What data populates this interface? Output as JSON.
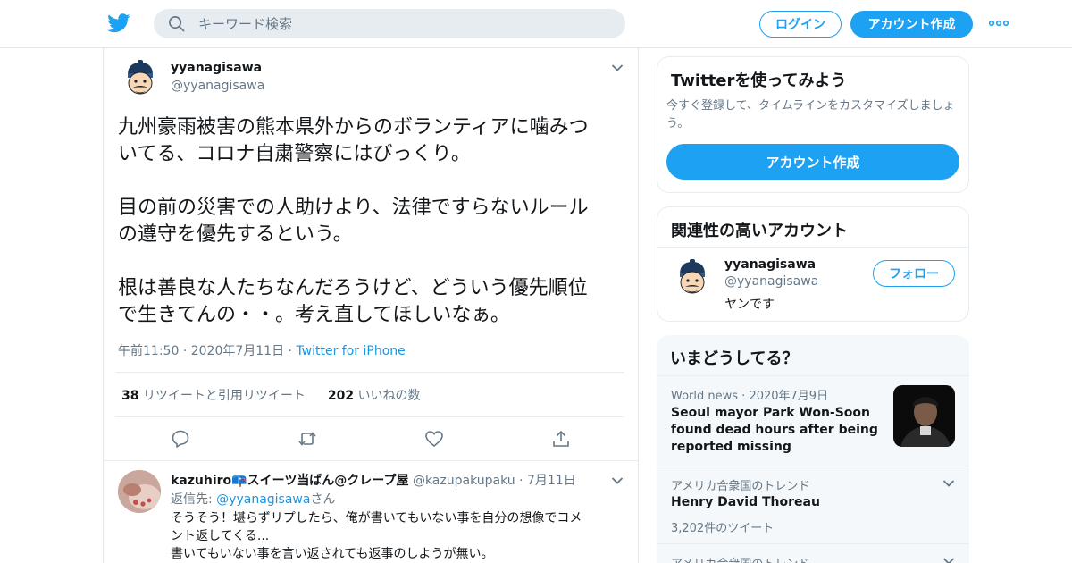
{
  "header": {
    "search_placeholder": "キーワード検索",
    "login_label": "ログイン",
    "signup_label": "アカウント作成"
  },
  "tweet": {
    "author_name": "yyanagisawa",
    "author_handle": "@yyanagisawa",
    "text": "九州豪雨被害の熊本県外からのボランティアに噛みつ\nいてる、コロナ自粛警察にはびっくり。\n\n目の前の災害での人助けより、法律ですらないルール\nの遵守を優先するという。\n\n根は善良な人たちなんだろうけど、どういう優先順位\nで生きてんの・・。考え直してほしいなぁ。",
    "time": "午前11:50",
    "date": "2020年7月11日",
    "source": "Twitter for iPhone",
    "retweet_count": "38",
    "retweet_label": "リツイートと引用リツイート",
    "like_count": "202",
    "like_label": "いいねの数"
  },
  "reply": {
    "author_name": "kazuhiro📪スイーツ当ばん@クレープ屋",
    "author_handle": "@kazupakupaku",
    "date": "7月11日",
    "reply_prefix": "返信先: ",
    "reply_to": "@yyanagisawa",
    "reply_suffix": "さん",
    "line1": "そうそう！堪らずリプしたら、俺が書いてもいない事を自分の想像でコメ",
    "line2": "ント返してくる...",
    "line3": "書いてもいない事を言い返されても返事のしようが無い。"
  },
  "signup_card": {
    "title": "Twitterを使ってみよう",
    "desc_line1": "今すぐ登録して、タイムラインをカスタマイズしましょ",
    "desc_line2": "う。",
    "button_label": "アカウント作成"
  },
  "related_card": {
    "title": "関連性の高いアカウント",
    "name": "yyanagisawa",
    "handle": "@yyanagisawa",
    "bio": "ヤンです",
    "follow_label": "フォロー"
  },
  "trends_card": {
    "title": "いまどうしてる？",
    "items": [
      {
        "context": "World news",
        "date": "2020年7月9日",
        "title": "Seoul mayor Park Won-Soon found dead hours after being reported missing"
      },
      {
        "context": "アメリカ合衆国のトレンド",
        "title": "Henry David Thoreau",
        "count": "3,202件のツイート"
      },
      {
        "context": "アメリカ合衆国のトレンド"
      }
    ]
  },
  "colors": {
    "accent": "#1da1f2",
    "link": "#1b95e0",
    "text": "#14171a",
    "muted": "#657786",
    "border": "#e6ecf0"
  },
  "icons": [
    "twitter-bird-icon",
    "search-icon",
    "more-dots-icon",
    "chevron-down-icon",
    "reply-icon",
    "retweet-icon",
    "like-icon",
    "share-icon"
  ]
}
